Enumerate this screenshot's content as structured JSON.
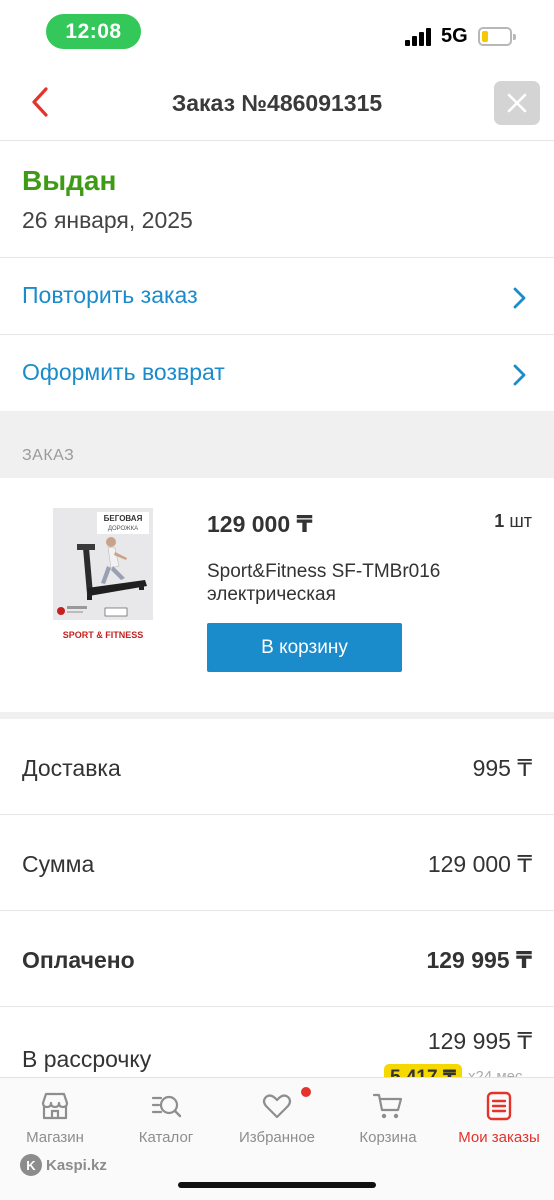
{
  "status_bar": {
    "time": "12:08",
    "network": "5G"
  },
  "header": {
    "title": "Заказ №486091315"
  },
  "order": {
    "status": "Выдан",
    "date": "26 января, 2025",
    "status_color": "#3f9b15"
  },
  "actions": [
    {
      "label": "Повторить заказ"
    },
    {
      "label": "Оформить возврат"
    }
  ],
  "section_label": "ЗАКАЗ",
  "product": {
    "price": "129 000 ₸",
    "quantity": "1",
    "quantity_unit": "шт",
    "name": "Sport&Fitness SF-TMBr016 электрическая",
    "cart_button": "В корзину",
    "image": {
      "title": "БЕГОВАЯ",
      "subtitle": "ДОРОЖКА",
      "brand": "SPORT & FITNESS"
    }
  },
  "summary": [
    {
      "label": "Доставка",
      "value": "995 ₸"
    },
    {
      "label": "Сумма",
      "value": "129 000 ₸"
    },
    {
      "label": "Оплачено",
      "value": "129 995 ₸"
    }
  ],
  "installment": {
    "label": "В рассрочку",
    "value": "129 995 ₸",
    "monthly": "5 417 ₸",
    "term": "х24 мес"
  },
  "tabs": [
    {
      "label": "Магазин",
      "icon": "store-icon"
    },
    {
      "label": "Каталог",
      "icon": "catalog-search-icon"
    },
    {
      "label": "Избранное",
      "icon": "heart-icon"
    },
    {
      "label": "Корзина",
      "icon": "cart-icon"
    },
    {
      "label": "Мои заказы",
      "icon": "orders-icon"
    }
  ],
  "footer_brand": "Kaspi.kz",
  "colors": {
    "accent_blue": "#1a8bcb",
    "active_red": "#e4332b",
    "status_green": "#3f9b15",
    "installment_yellow": "#f5d800"
  }
}
